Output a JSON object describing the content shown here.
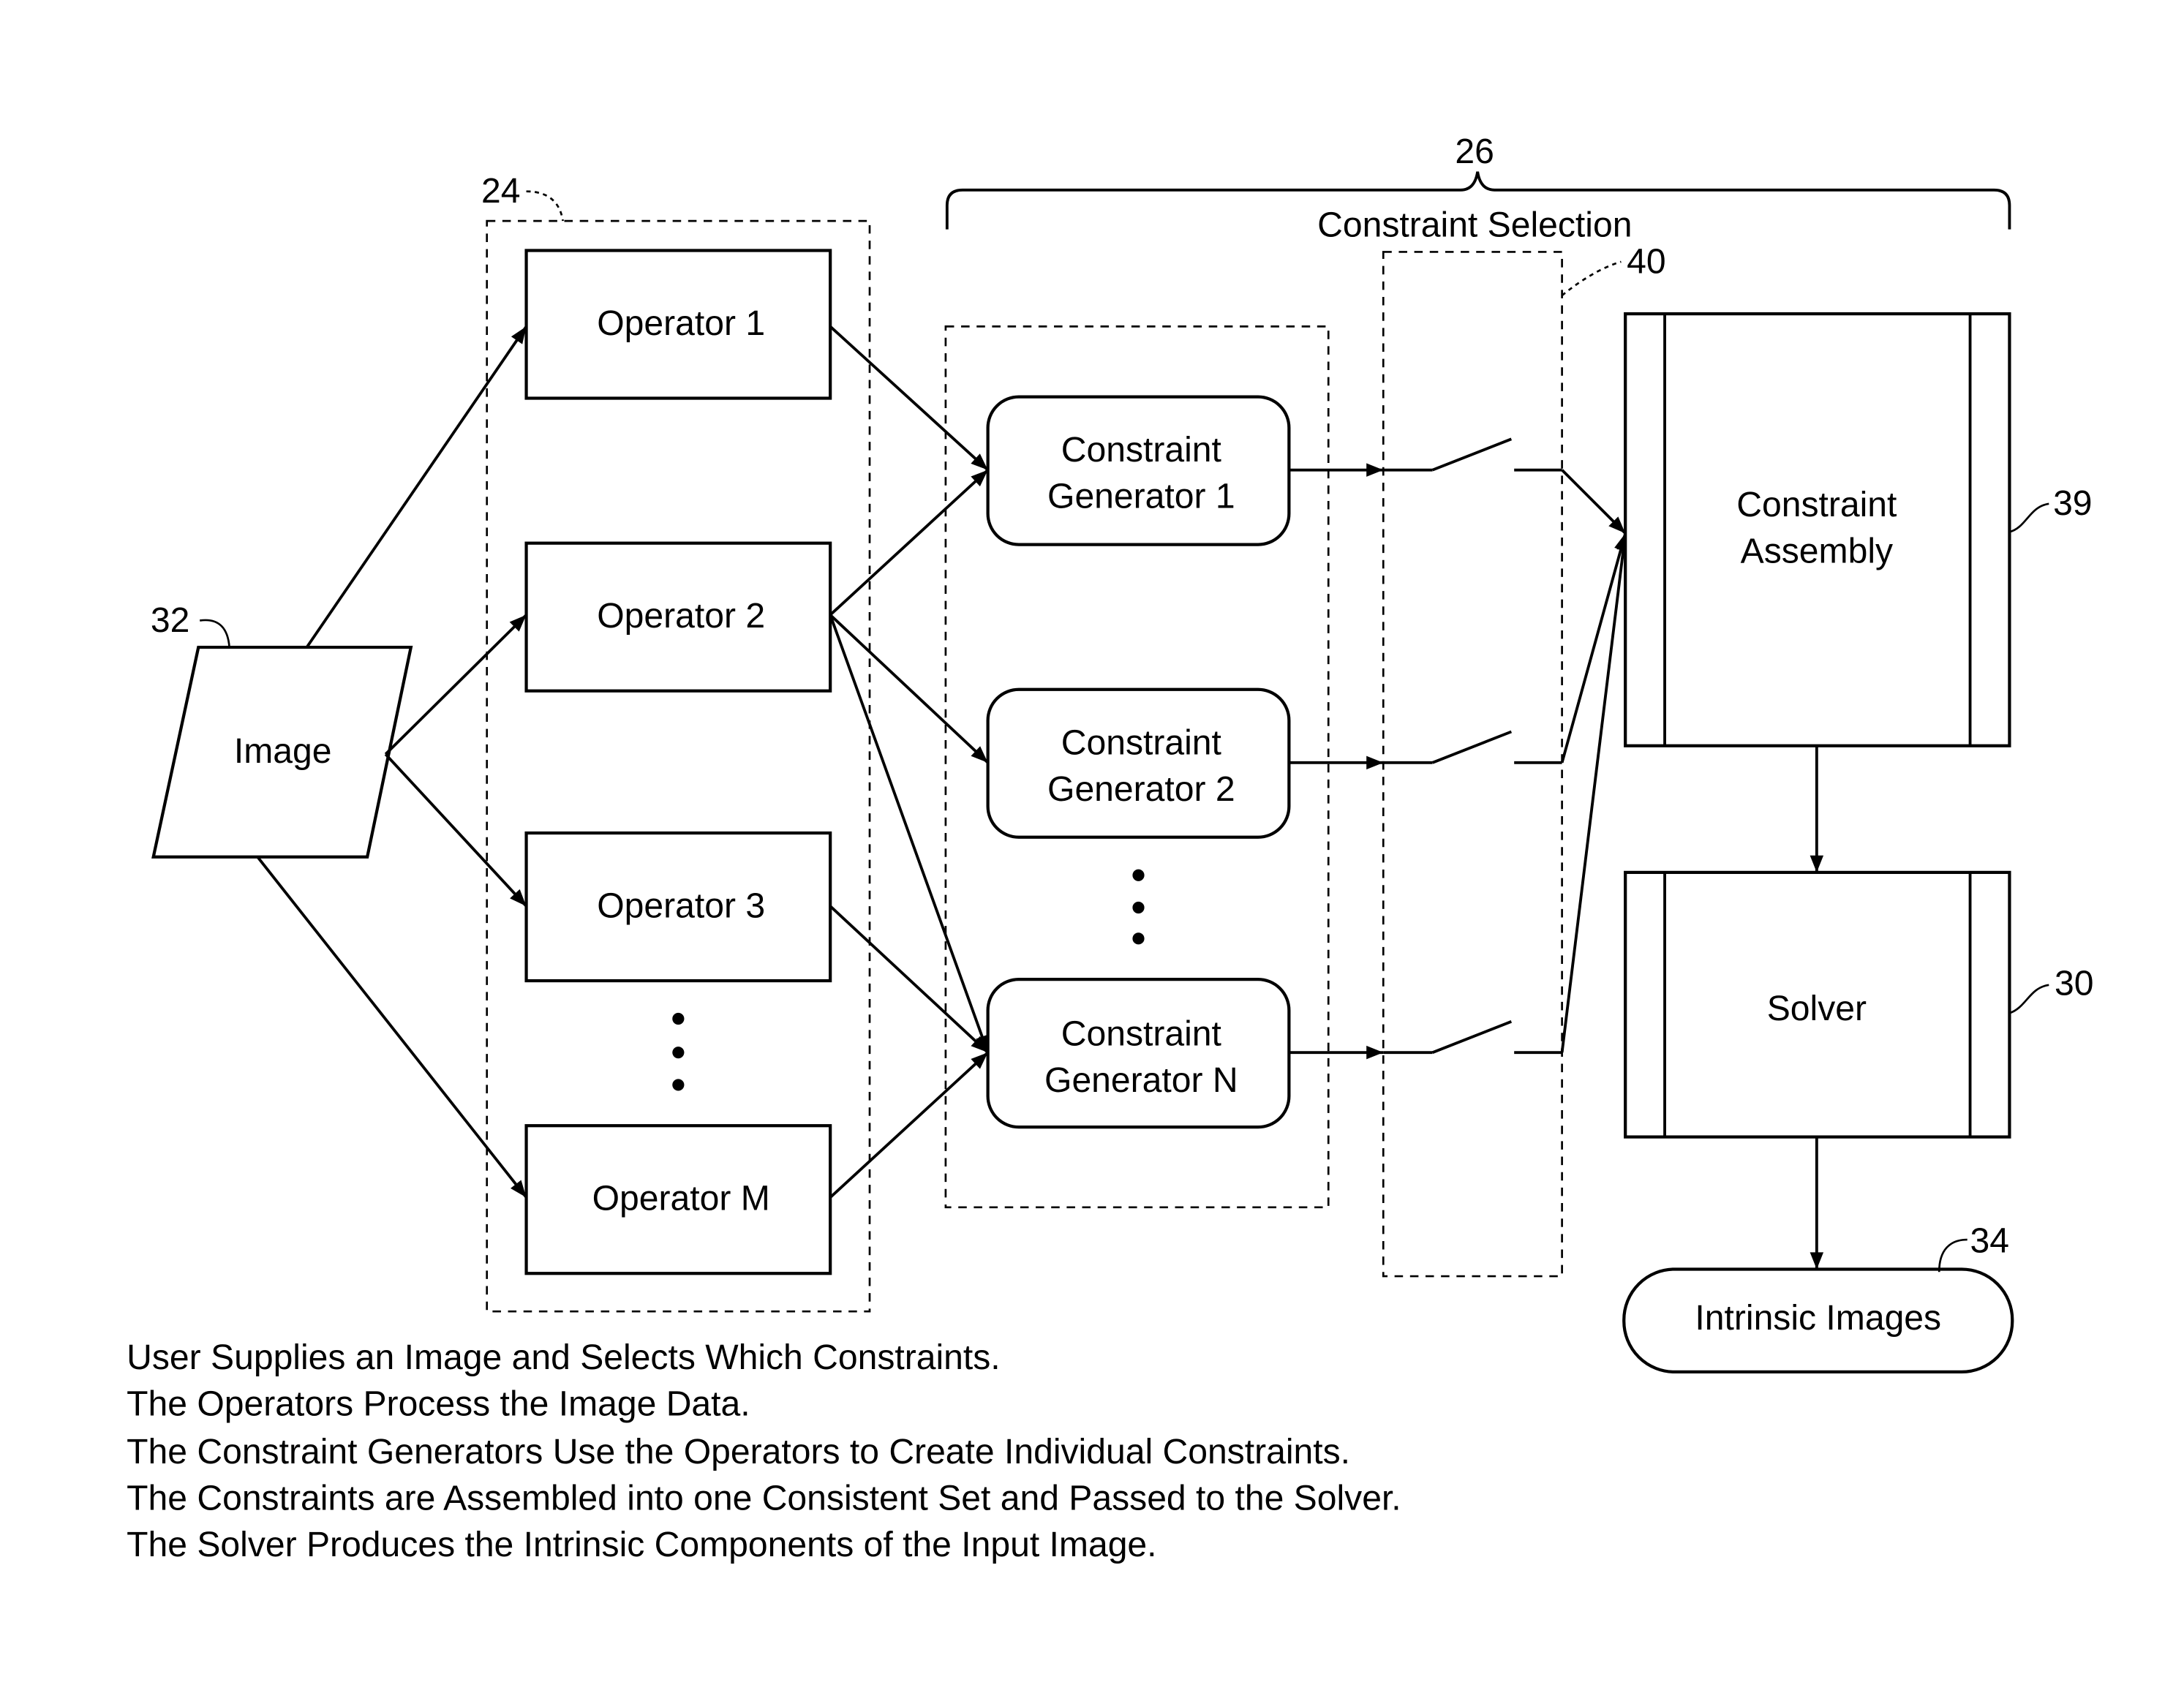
{
  "diagram": {
    "input": {
      "label": "Image",
      "ref": "32"
    },
    "operators_group": {
      "ref": "24"
    },
    "operators": [
      {
        "label": "Operator 1"
      },
      {
        "label": "Operator 2"
      },
      {
        "label": "Operator 3"
      },
      {
        "label": "Operator M"
      }
    ],
    "constraint_selection": {
      "label": "Constraint Selection",
      "ref": "26"
    },
    "generators": [
      {
        "line1": "Constraint",
        "line2": "Generator 1"
      },
      {
        "line1": "Constraint",
        "line2": "Generator 2"
      },
      {
        "line1": "Constraint",
        "line2": "Generator N"
      }
    ],
    "switches_group": {
      "ref": "40"
    },
    "assembly": {
      "line1": "Constraint",
      "line2": "Assembly",
      "ref": "39"
    },
    "solver": {
      "label": "Solver",
      "ref": "30"
    },
    "output": {
      "label": "Intrinsic Images",
      "ref": "34"
    },
    "ellipsis": "⋮"
  },
  "caption": [
    "User Supplies an Image and Selects Which Constraints.",
    "The Operators Process the Image Data.",
    "The Constraint Generators Use the Operators to Create Individual Constraints.",
    "The Constraints are Assembled into one Consistent Set and Passed to the Solver.",
    "The Solver Produces the Intrinsic Components of the Input Image."
  ]
}
